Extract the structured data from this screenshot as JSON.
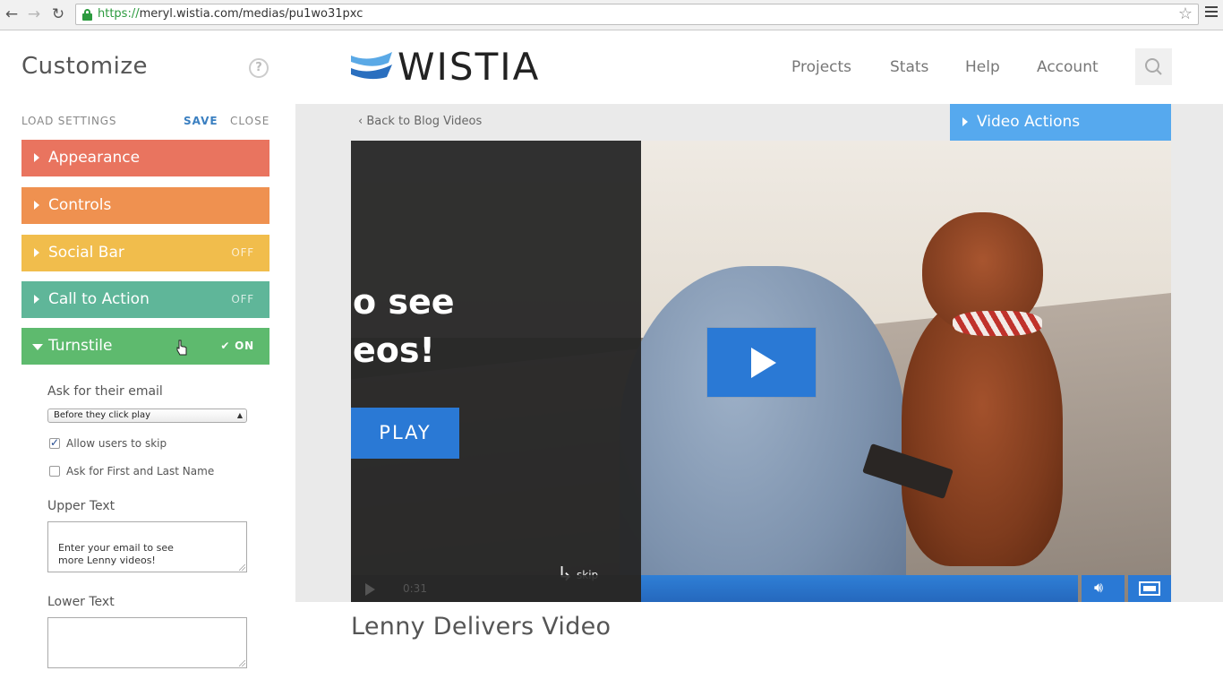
{
  "browser": {
    "url_scheme": "https://",
    "url_rest": "meryl.wistia.com/medias/pu1wo31pxc",
    "back_glyph": "←",
    "forward_glyph": "→",
    "reload_glyph": "↻",
    "star_glyph": "☆"
  },
  "panel": {
    "title": "Customize",
    "help_glyph": "?",
    "load_settings": "LOAD SETTINGS",
    "save": "SAVE",
    "close": "CLOSE",
    "sections": [
      {
        "label": "Appearance",
        "state": "",
        "color": "#e9745f"
      },
      {
        "label": "Controls",
        "state": "",
        "color": "#ef9150"
      },
      {
        "label": "Social Bar",
        "state": "OFF",
        "color": "#f1bd4c"
      },
      {
        "label": "Call to Action",
        "state": "OFF",
        "color": "#5fb699"
      },
      {
        "label": "Turnstile",
        "state": "✔ ON",
        "color": "#5eba6e",
        "expanded": true
      }
    ],
    "turnstile": {
      "ask_email_label": "Ask for their email",
      "timing_value": "Before they click play",
      "allow_skip_label": "Allow users to skip",
      "allow_skip_checked": true,
      "ask_name_label": "Ask for First and Last Name",
      "ask_name_checked": false,
      "upper_text_label": "Upper Text",
      "upper_text_value": "Enter your email to see\nmore Lenny videos!",
      "lower_text_label": "Lower Text",
      "lower_text_value": ""
    }
  },
  "header": {
    "logo_text": "WISTIA",
    "nav": [
      "Projects",
      "Stats",
      "Help",
      "Account"
    ],
    "search_icon": "search-icon"
  },
  "main": {
    "back_link": "Back to Blog Videos",
    "video_actions": "Video Actions",
    "turnstile_overlay": {
      "line1": "o see",
      "line2": "eos!",
      "play_button": "PLAY",
      "skip": "skip"
    },
    "controls": {
      "time": "0:31"
    },
    "media_title": "Lenny Delivers Video"
  },
  "colors": {
    "accent_blue": "#2a79d5",
    "video_actions_blue": "#56a9ee",
    "save_blue": "#3a7fc1"
  }
}
